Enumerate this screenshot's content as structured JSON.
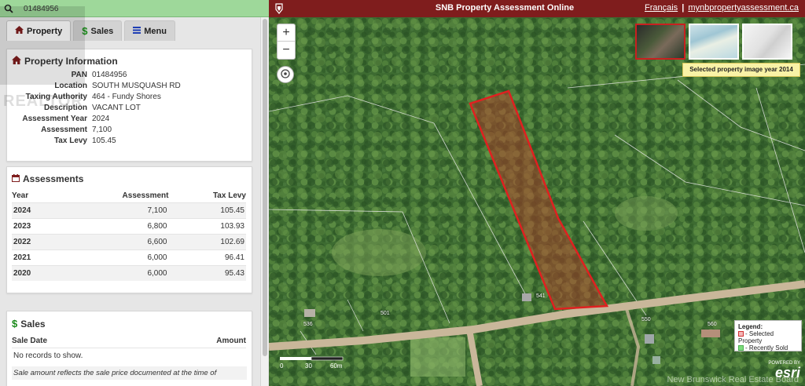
{
  "search": {
    "value": "01484956"
  },
  "tabs": [
    {
      "label": "Property",
      "icon": "home-icon"
    },
    {
      "label": "Sales",
      "icon": "dollar-icon"
    },
    {
      "label": "Menu",
      "icon": "menu-icon"
    }
  ],
  "property": {
    "title": "Property Information",
    "fields": [
      {
        "key": "PAN",
        "value": "01484956"
      },
      {
        "key": "Location",
        "value": "SOUTH MUSQUASH RD"
      },
      {
        "key": "Taxing Authority",
        "value": "464 - Fundy Shores"
      },
      {
        "key": "Description",
        "value": "VACANT LOT"
      },
      {
        "key": "Assessment Year",
        "value": "2024"
      },
      {
        "key": "Assessment",
        "value": "7,100"
      },
      {
        "key": "Tax Levy",
        "value": "105.45"
      }
    ]
  },
  "assessments": {
    "title": "Assessments",
    "columns": [
      "Year",
      "Assessment",
      "Tax Levy"
    ],
    "rows": [
      {
        "year": "2024",
        "assessment": "7,100",
        "tax_levy": "105.45"
      },
      {
        "year": "2023",
        "assessment": "6,800",
        "tax_levy": "103.93"
      },
      {
        "year": "2022",
        "assessment": "6,600",
        "tax_levy": "102.69"
      },
      {
        "year": "2021",
        "assessment": "6,000",
        "tax_levy": "96.41"
      },
      {
        "year": "2020",
        "assessment": "6,000",
        "tax_levy": "95.43"
      }
    ]
  },
  "sales": {
    "title": "Sales",
    "columns": [
      "Sale Date",
      "Amount"
    ],
    "empty": "No records to show.",
    "note": "Sale amount reflects the sale price documented at the time of"
  },
  "header": {
    "title": "SNB Property Assessment Online",
    "link_fr": "Français",
    "separator": "|",
    "link_site": "mynbpropertyassessment.ca"
  },
  "map": {
    "zoom_in": "+",
    "zoom_out": "−",
    "image_year": "Selected property image year 2014",
    "legend": {
      "title": "Legend:",
      "selected": "- Selected Property",
      "sold": "- Recently Sold"
    },
    "scale": {
      "t0": "0",
      "t1": "30",
      "t2": "60m"
    },
    "esri": {
      "powered": "POWERED BY",
      "brand": "esri"
    },
    "lot_labels": [
      "541",
      "501",
      "536",
      "550",
      "560"
    ],
    "watermark": "New Brunswick Real Estate Board"
  },
  "watermark_left": "REALTOR",
  "colors": {
    "header": "#7f1d1d",
    "search_bar": "#9ed89a",
    "selected_property": "#d03030",
    "recently_sold": "#7ddc7d",
    "image_year_bg": "#f9f2a6"
  }
}
